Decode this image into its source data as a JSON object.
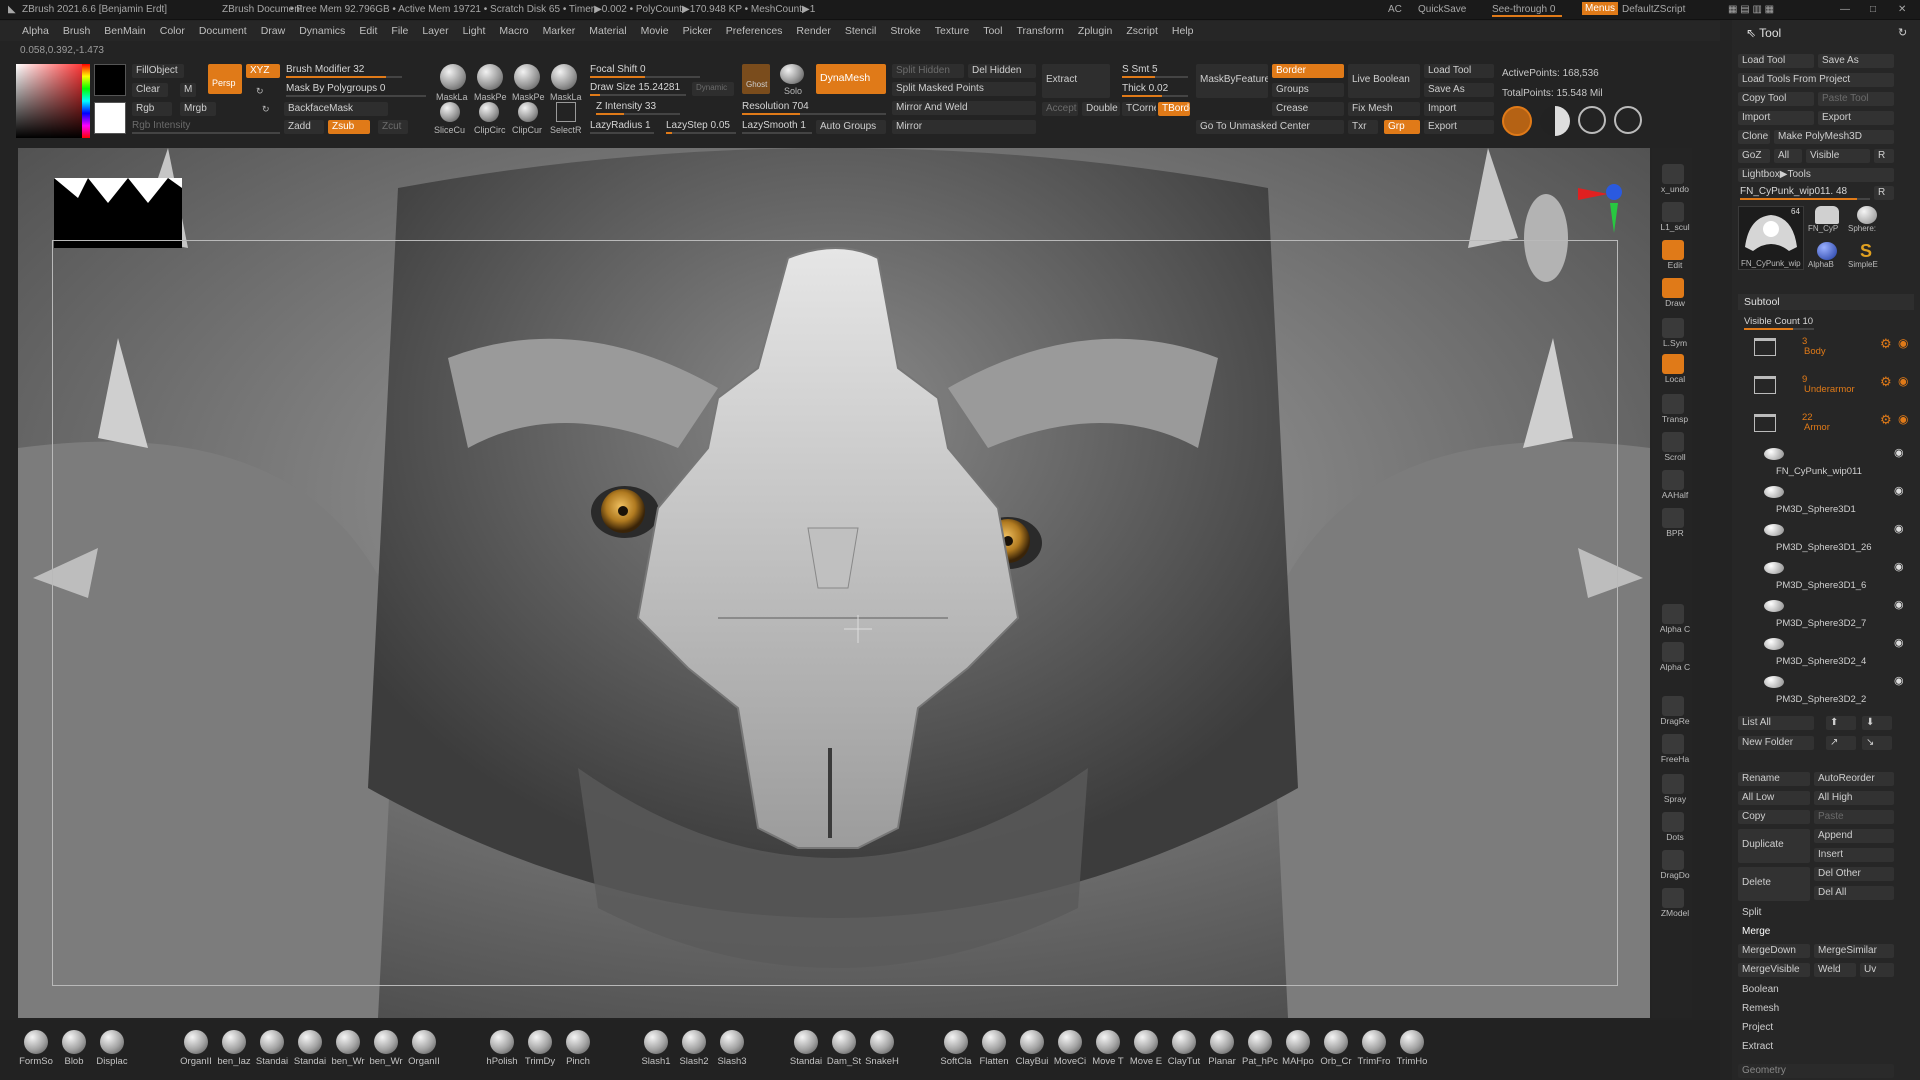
{
  "title_bar": {
    "app": "ZBrush 2021.6.6 [Benjamin Erdt]",
    "doc": "ZBrush Document",
    "stats": "• Free Mem 92.796GB • Active Mem 19721 • Scratch Disk 65 • Timer▶0.002 • PolyCount▶170.948 KP • MeshCount▶1",
    "ac": "AC",
    "quicksave": "QuickSave",
    "seethrough": "See-through 0",
    "menus_btn": "Menus",
    "script": "DefaultZScript"
  },
  "menu": [
    "Alpha",
    "Brush",
    "BenMain",
    "Color",
    "Document",
    "Draw",
    "Dynamics",
    "Edit",
    "File",
    "Layer",
    "Light",
    "Macro",
    "Marker",
    "Material",
    "Movie",
    "Picker",
    "Preferences",
    "Render",
    "Stencil",
    "Stroke",
    "Texture",
    "Tool",
    "Transform",
    "Zplugin",
    "Zscript",
    "Help"
  ],
  "coords": "0.058,0.392,-1.473",
  "colors": {
    "accent": "#e07a18",
    "bg": "#232323",
    "panel": "#262626",
    "button": "#2e2e2e",
    "axis_red": "#e02020",
    "axis_blue": "#2a5ae0",
    "axis_green": "#28c840"
  },
  "shelf": {
    "fill_object": "FillObject",
    "clear": "Clear",
    "m": "M",
    "rgb": "Rgb",
    "mrgb": "Mrgb",
    "rgb_intensity": "Rgb Intensity",
    "persp": "Persp",
    "xyz": "XYZ",
    "brush_modifier": "Brush Modifier 32",
    "mask_by_polygroups": "Mask By Polygroups 0",
    "backface_mask": "BackfaceMask",
    "zadd": "Zadd",
    "zsub": "Zsub",
    "zcut": "Zcut",
    "mask_icons": [
      "MaskLa",
      "MaskPe",
      "MaskPe",
      "MaskLa"
    ],
    "clip_icons": [
      "SliceCu",
      "ClipCirc",
      "ClipCur",
      "SelectR"
    ],
    "focal_shift": "Focal Shift 0",
    "draw_size": "Draw Size 15.24281",
    "dynamic": "Dynamic",
    "z_intensity": "Z Intensity 33",
    "lazy_radius": "LazyRadius 1",
    "lazy_step": "LazyStep 0.05",
    "lazy_smooth": "LazySmooth 1",
    "ghost": "Ghost",
    "solo": "Solo",
    "dynamesh": "DynaMesh",
    "resolution": "Resolution 704",
    "auto_groups": "Auto Groups",
    "split_hidden": "Split Hidden",
    "del_hidden": "Del Hidden",
    "split_masked_points": "Split Masked Points",
    "mirror_and_weld": "Mirror And Weld",
    "mirror": "Mirror",
    "extract": "Extract",
    "s_smt": "S Smt 5",
    "thick": "Thick 0.02",
    "accept": "Accept",
    "double": "Double",
    "tcorne": "TCorne",
    "tborde": "TBorde",
    "mask_by_feature": "MaskByFeature",
    "border": "Border",
    "groups": "Groups",
    "crease": "Crease",
    "go_to_unmasked": "Go To Unmasked Center",
    "live_boolean": "Live Boolean",
    "fix_mesh": "Fix Mesh",
    "txr": "Txr",
    "grp": "Grp",
    "load_tool": "Load Tool",
    "save_as": "Save As",
    "import": "Import",
    "export": "Export",
    "active_points": "ActivePoints: 168,536",
    "total_points": "TotalPoints: 15.548 Mil"
  },
  "right_bar": [
    {
      "icon": "undo-sphere-icon",
      "label": "x_undo"
    },
    {
      "icon": "sculpt-sphere-icon",
      "label": "L1_scul"
    },
    {
      "icon": "edit-icon",
      "label": "Edit"
    },
    {
      "icon": "draw-icon",
      "label": "Draw"
    },
    {
      "icon": "lsym-icon",
      "label": "L.Sym"
    },
    {
      "icon": "local-icon",
      "label": "Local"
    },
    {
      "icon": "transp-icon",
      "label": "Transp"
    },
    {
      "icon": "scroll-icon",
      "label": "Scroll"
    },
    {
      "icon": "aahalf-icon",
      "label": "AAHalf"
    },
    {
      "icon": "bpr-icon",
      "label": "BPR"
    },
    {
      "icon": "alpha-icon",
      "label": "Alpha C"
    },
    {
      "icon": "alpha-icon",
      "label": "Alpha C"
    },
    {
      "icon": "dragrect-icon",
      "label": "DragRe"
    },
    {
      "icon": "freehand-icon",
      "label": "FreeHa"
    },
    {
      "icon": "spray-icon",
      "label": "Spray"
    },
    {
      "icon": "dots-icon",
      "label": "Dots"
    },
    {
      "icon": "dragdot-icon",
      "label": "DragDo"
    },
    {
      "icon": "zmodel-icon",
      "label": "ZModel"
    }
  ],
  "tool": {
    "header": "Tool",
    "load_tool": "Load Tool",
    "save_as": "Save As",
    "load_tools_from_project": "Load Tools From Project",
    "copy_tool": "Copy Tool",
    "paste_tool": "Paste Tool",
    "import": "Import",
    "export": "Export",
    "clone": "Clone",
    "make_polymesh": "Make PolyMesh3D",
    "goz": "GoZ",
    "all": "All",
    "visible": "Visible",
    "r": "R",
    "lightbox_tools": "Lightbox▶Tools",
    "current_tool": "FN_CyPunk_wip011. 48",
    "r2": "R",
    "thumbs": [
      "FN_CyPunk_wip",
      "FN_CyP",
      "Sphere:",
      "AlphaB",
      "SimpleE"
    ],
    "thumb_count": "64",
    "subtool_header": "Subtool",
    "visible_count": "Visible Count 10",
    "folders": [
      {
        "count": "3",
        "name": "Body"
      },
      {
        "count": "9",
        "name": "Underarmor"
      },
      {
        "count": "22",
        "name": "Armor"
      }
    ],
    "subtools": [
      "FN_CyPunk_wip011",
      "PM3D_Sphere3D1",
      "PM3D_Sphere3D1_26",
      "PM3D_Sphere3D1_6",
      "PM3D_Sphere3D2_7",
      "PM3D_Sphere3D2_4",
      "PM3D_Sphere3D2_2"
    ],
    "list_all": "List All",
    "new_folder": "New Folder",
    "rename": "Rename",
    "auto_reorder": "AutoReorder",
    "all_low": "All Low",
    "all_high": "All High",
    "copy": "Copy",
    "paste": "Paste",
    "duplicate": "Duplicate",
    "append": "Append",
    "insert": "Insert",
    "delete": "Delete",
    "del_other": "Del Other",
    "del_all": "Del All",
    "split": "Split",
    "merge": "Merge",
    "merge_down": "MergeDown",
    "merge_similar": "MergeSimilar",
    "merge_visible": "MergeVisible",
    "weld": "Weld",
    "uv": "Uv",
    "boolean": "Boolean",
    "remesh": "Remesh",
    "project": "Project",
    "extract": "Extract",
    "geometry": "Geometry"
  },
  "bottom_brushes": [
    "FormSo",
    "Blob",
    "Displac",
    "OrganII",
    "ben_laz",
    "Standai",
    "Standai",
    "ben_Wr",
    "ben_Wr",
    "OrganII",
    "hPolish",
    "TrimDy",
    "Pinch",
    "Slash1",
    "Slash2",
    "Slash3",
    "Standai",
    "Dam_St",
    "SnakeH",
    "SoftCla",
    "Flatten",
    "ClayBui",
    "MoveCi",
    "Move T",
    "Move E",
    "ClayTut",
    "Planar",
    "Pat_hPc",
    "MAHpo",
    "Orb_Cr",
    "TrimFro",
    "TrimHo"
  ]
}
